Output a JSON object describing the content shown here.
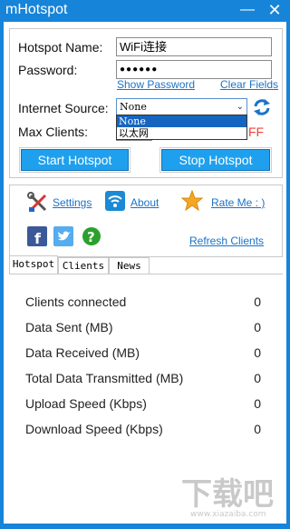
{
  "window": {
    "title": "mHotspot",
    "minimize_glyph": "—",
    "close_glyph": "✕"
  },
  "settings": {
    "hotspot_name_label": "Hotspot Name:",
    "hotspot_name_value": "WiFi连接",
    "password_label": "Password:",
    "password_value": "●●●●●●",
    "show_password_link": "Show Password",
    "clear_fields_link": "Clear Fields",
    "internet_source_label": "Internet Source:",
    "internet_source_value": "None",
    "internet_source_options": [
      "None",
      "以太网"
    ],
    "max_clients_label": "Max Clients:",
    "toggle_partial_text": "FF"
  },
  "buttons": {
    "start": "Start Hotspot",
    "stop": "Stop Hotspot"
  },
  "links": {
    "settings": "Settings",
    "about": "About",
    "rate_me": "Rate Me : )",
    "refresh_clients": "Refresh Clients"
  },
  "tabs": [
    "Hotspot",
    "Clients",
    "News"
  ],
  "stats": [
    {
      "label": "Clients connected",
      "value": "0"
    },
    {
      "label": "Data Sent (MB)",
      "value": "0"
    },
    {
      "label": "Data Received (MB)",
      "value": "0"
    },
    {
      "label": "Total Data Transmitted (MB)",
      "value": "0"
    },
    {
      "label": "Upload Speed (Kbps)",
      "value": "0"
    },
    {
      "label": "Download Speed (Kbps)",
      "value": "0"
    }
  ],
  "icons": {
    "settings": "tools-icon",
    "about": "wifi-icon",
    "rate_me": "star-icon",
    "facebook": "facebook-icon",
    "twitter": "twitter-icon",
    "help": "help-icon",
    "refresh": "refresh-icon"
  },
  "colors": {
    "titlebar": "#1684d9",
    "button": "#1ea0ee",
    "link": "#1a73c9",
    "toggle_off": "#e8443a"
  },
  "watermark": {
    "main": "下载吧",
    "sub": "www.xiazaiba.com"
  }
}
